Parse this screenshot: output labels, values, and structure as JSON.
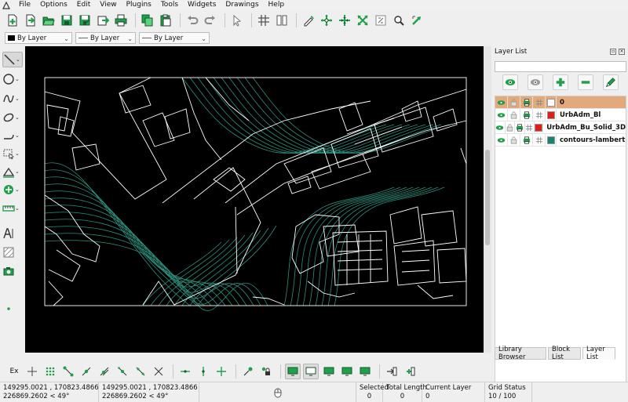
{
  "menu": {
    "items": [
      "File",
      "Options",
      "Edit",
      "View",
      "Plugins",
      "Tools",
      "Widgets",
      "Drawings",
      "Help"
    ]
  },
  "pen_toolbar": {
    "color": "By Layer",
    "width": "By Layer",
    "linetype": "By Layer"
  },
  "layer_dock": {
    "title": "Layer List",
    "filter_placeholder": "",
    "layers": [
      {
        "name": "0",
        "color": "#ffffff",
        "selected": true
      },
      {
        "name": "UrbAdm_Bl",
        "color": "#e21b1b",
        "selected": false
      },
      {
        "name": "UrbAdm_Bu_Solid_3D",
        "color": "#e21b1b",
        "selected": false
      },
      {
        "name": "contours-lambert",
        "color": "#128573",
        "selected": false
      }
    ],
    "tabs": [
      "Library Browser",
      "Block List",
      "Layer List"
    ],
    "active_tab": "Layer List"
  },
  "snap_toolbar": {
    "ex_label": "Ex"
  },
  "status": {
    "abs_coord_1": "149295.0021 , 170823.4866",
    "abs_coord_2": "226869.2602 < 49°",
    "rel_coord_1": "149295.0021 , 170823.4866",
    "rel_coord_2": "226869.2602 < 49°",
    "selected_label": "Selected",
    "selected_value": "0",
    "total_length_label": "Total Length",
    "total_length_value": "0",
    "current_layer_label": "Current Layer",
    "current_layer_value": "0",
    "grid_status_label": "Grid Status",
    "grid_status_value": "10 / 100"
  },
  "colors": {
    "canvas_bg": "#000000",
    "drawing_lines": "#ffffff",
    "contour_lines": "#2e8f7e",
    "selected_layer_row": "#e4a97a",
    "icon_green": "#1fa04a"
  }
}
